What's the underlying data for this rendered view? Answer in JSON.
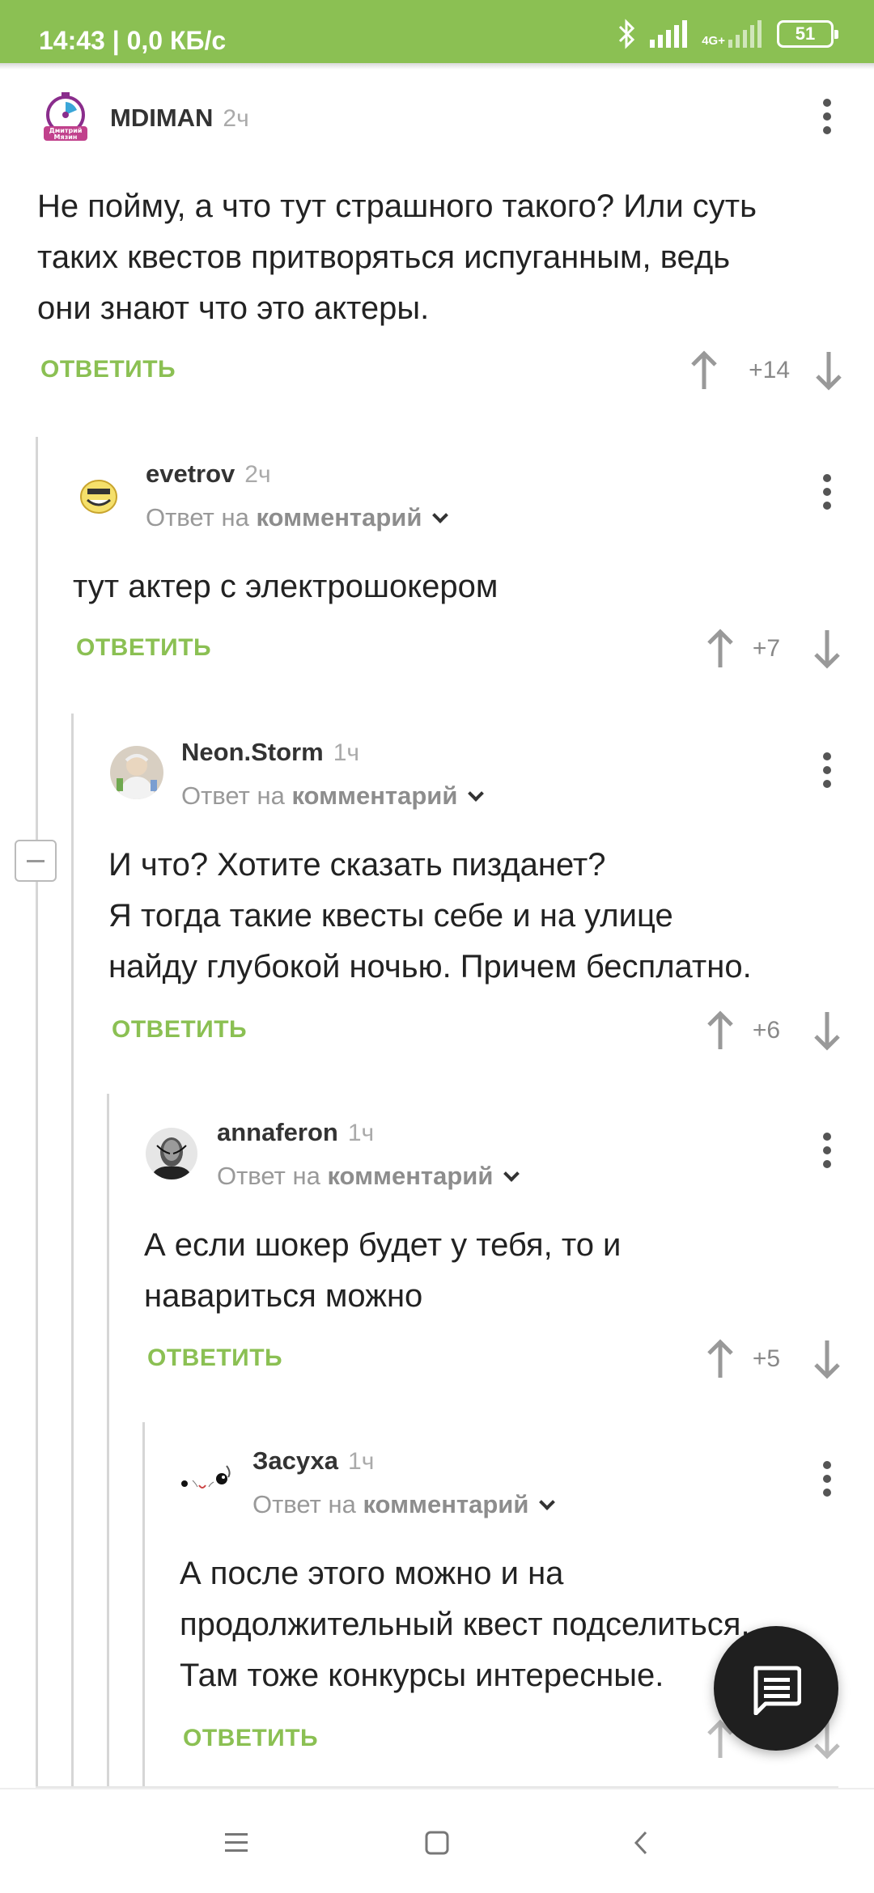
{
  "status_bar": {
    "time_speed": "14:43 | 0,0 КБ/с",
    "network": "4G+",
    "battery": "51"
  },
  "comments": [
    {
      "author": "MDIMAN",
      "time": "2ч",
      "avatar_text": "Дмитрий Мязин",
      "text_lines": [
        "Не пойму, а что тут страшного такого? Или суть",
        "таких квестов притворяться испуганным, ведь",
        "они знают что это актеры."
      ],
      "reply_label": "ОТВЕТИТЬ",
      "rating": "+14"
    },
    {
      "author": "evetrov",
      "time": "2ч",
      "reply_prefix": "Ответ на",
      "reply_target": "комментарий",
      "text_lines": [
        "тут актер с электрошокером"
      ],
      "reply_label": "ОТВЕТИТЬ",
      "rating": "+7"
    },
    {
      "author": "Neon.Storm",
      "time": "1ч",
      "reply_prefix": "Ответ на",
      "reply_target": "комментарий",
      "text_lines": [
        "И что? Хотите сказать пизданет?",
        "Я тогда такие квесты себе и на улице",
        "найду глубокой ночью. Причем бесплатно."
      ],
      "reply_label": "ОТВЕТИТЬ",
      "rating": "+6"
    },
    {
      "author": "annaferon",
      "time": "1ч",
      "reply_prefix": "Ответ на",
      "reply_target": "комментарий",
      "text_lines": [
        "А если шокер будет у тебя, то и",
        "навариться можно"
      ],
      "reply_label": "ОТВЕТИТЬ",
      "rating": "+5"
    },
    {
      "author": "Засуха",
      "time": "1ч",
      "reply_prefix": "Ответ на",
      "reply_target": "комментарий",
      "text_lines": [
        "А после этого можно и на",
        "продолжительный квест подселиться.",
        "Там тоже конкурсы интересные."
      ],
      "reply_label": "ОТВЕТИТЬ"
    }
  ],
  "icons": {
    "fab": "chat-icon",
    "nav": [
      "menu-icon",
      "home-icon",
      "back-icon"
    ]
  },
  "colors": {
    "accent": "#8bc053",
    "text": "#222222",
    "muted": "#999999",
    "fab": "#1f1f1f"
  }
}
